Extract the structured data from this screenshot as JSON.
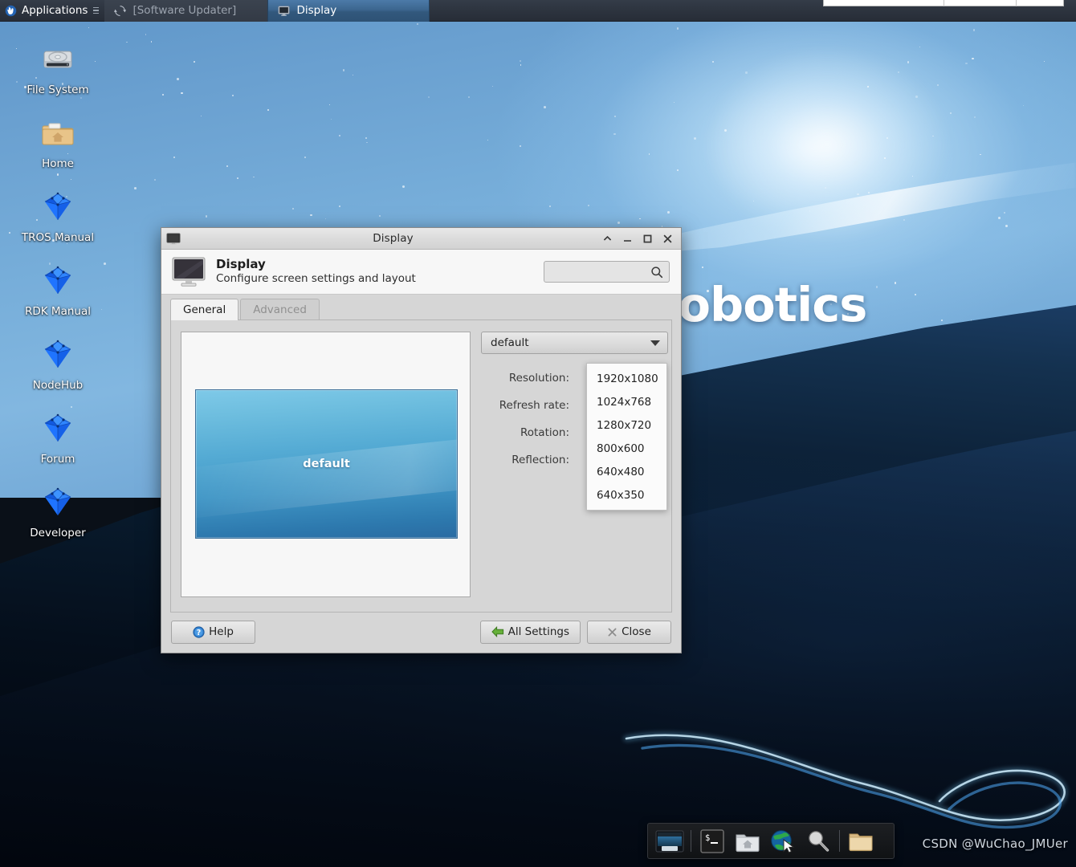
{
  "panel": {
    "applications_label": "Applications",
    "grip_icon": "grip-handle-icon",
    "mouse_icon": "mouse-cursor-icon",
    "tasks": [
      {
        "label": "[Software Updater]",
        "icon": "software-update-icon",
        "state": "inactive"
      },
      {
        "label": "Display",
        "icon": "monitor-icon",
        "state": "active"
      }
    ]
  },
  "wallpaper": {
    "text": "on Robotics"
  },
  "desktop_icons": [
    {
      "label": "File System",
      "icon": "hard-disk-icon"
    },
    {
      "label": "Home",
      "icon": "home-folder-icon"
    },
    {
      "label": "TROS Manual",
      "icon": "blue-gem-icon"
    },
    {
      "label": "RDK Manual",
      "icon": "blue-gem-icon"
    },
    {
      "label": "NodeHub",
      "icon": "blue-gem-icon"
    },
    {
      "label": "Forum",
      "icon": "blue-gem-icon"
    },
    {
      "label": "Developer",
      "icon": "blue-gem-icon"
    }
  ],
  "dialog": {
    "titlebar": {
      "title": "Display",
      "icon": "monitor-icon",
      "buttons": [
        {
          "name": "shade-button",
          "glyph": "⌃"
        },
        {
          "name": "minimize-button",
          "glyph": "—"
        },
        {
          "name": "maximize-button",
          "glyph": "□"
        },
        {
          "name": "close-button",
          "glyph": "✕"
        }
      ]
    },
    "header": {
      "title": "Display",
      "subtitle": "Configure screen settings and layout",
      "icon": "monitor-icon",
      "search_placeholder": "",
      "search_value": "",
      "search_icon": "search-icon"
    },
    "tabs": [
      {
        "label": "General",
        "state": "active"
      },
      {
        "label": "Advanced",
        "state": "inactive"
      }
    ],
    "preview": {
      "monitor_label": "default"
    },
    "display_combo": {
      "value": "default",
      "caret_icon": "chevron-down-icon"
    },
    "fields": [
      {
        "label": "Resolution:"
      },
      {
        "label": "Refresh rate:"
      },
      {
        "label": "Rotation:"
      },
      {
        "label": "Reflection:"
      }
    ],
    "resolution_menu": {
      "options": [
        "1920x1080",
        "1024x768",
        "1280x720",
        "800x600",
        "640x480",
        "640x350"
      ]
    },
    "footer": {
      "help_label": "Help",
      "help_icon": "help-circle-icon",
      "all_settings_label": "All Settings",
      "all_settings_icon": "back-arrow-icon",
      "close_label": "Close",
      "close_icon": "close-x-icon"
    }
  },
  "dock": {
    "items": [
      {
        "name": "show-desktop-icon",
        "title": "Show Desktop"
      },
      {
        "name": "separator"
      },
      {
        "name": "terminal-icon",
        "title": "Terminal"
      },
      {
        "name": "home-folder-icon",
        "title": "Home"
      },
      {
        "name": "web-browser-icon",
        "title": "Web Browser"
      },
      {
        "name": "magnifier-icon",
        "title": "Search"
      },
      {
        "name": "separator"
      },
      {
        "name": "file-manager-icon",
        "title": "File Manager"
      }
    ]
  },
  "watermark": {
    "text": "CSDN @WuChao_JMUer"
  },
  "colors": {
    "panel_bg": "#2d343f",
    "active_task": "#3c668f",
    "dialog_bg": "#d6d6d6",
    "accent_blue": "#4a90d9",
    "gem_blue": "#1464ff"
  }
}
